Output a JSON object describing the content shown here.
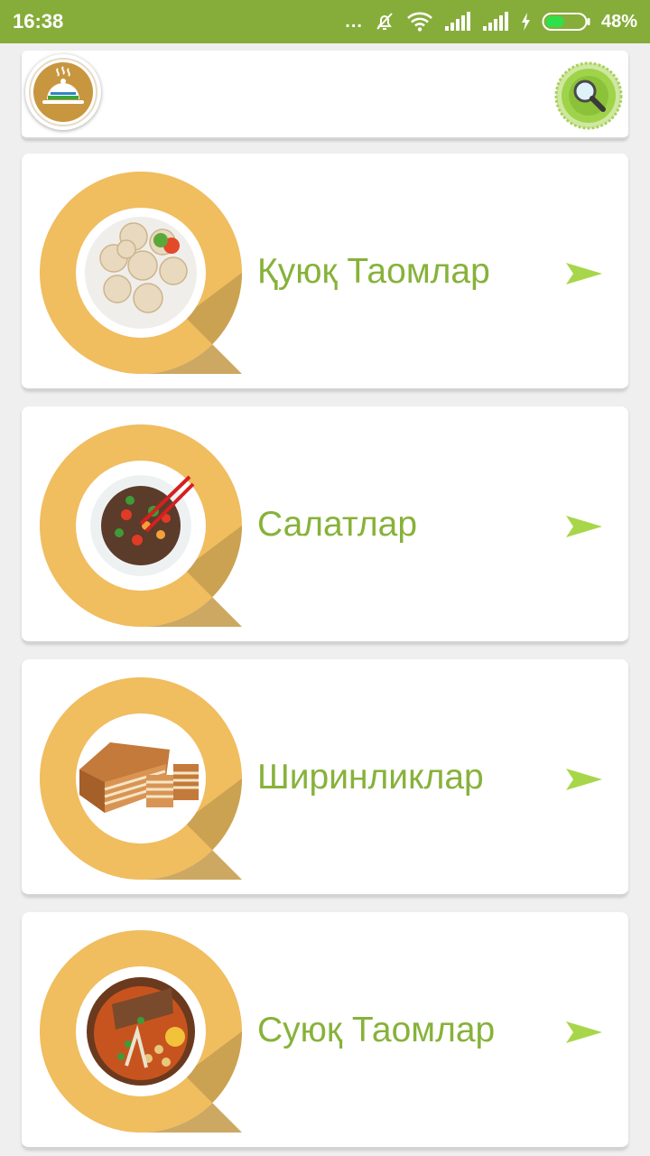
{
  "status_bar": {
    "time": "16:38",
    "dots": "...",
    "battery_percent": "48%",
    "battery_level": 0.48,
    "icons": [
      "dots-icon",
      "mute-bell-icon",
      "wifi-icon",
      "signal-icon",
      "signal-icon",
      "charging-icon",
      "battery-icon"
    ]
  },
  "header": {
    "logo_icon": "cloche-logo-icon",
    "search_icon": "magnifier-icon"
  },
  "categories": [
    {
      "label": "Қуюқ Таомлар",
      "image": "dumplings-plate-icon"
    },
    {
      "label": "Салатлар",
      "image": "salad-bowl-icon"
    },
    {
      "label": "Ширинликлар",
      "image": "layered-cake-icon"
    },
    {
      "label": "Суюқ Таомлар",
      "image": "soup-bowl-icon"
    }
  ],
  "colors": {
    "status_bar": "#86ad3a",
    "accent_text": "#87b23a",
    "disc": "#f0bd5f",
    "disc_shadow": "#c79e51",
    "arrow": "#a8d64a"
  }
}
